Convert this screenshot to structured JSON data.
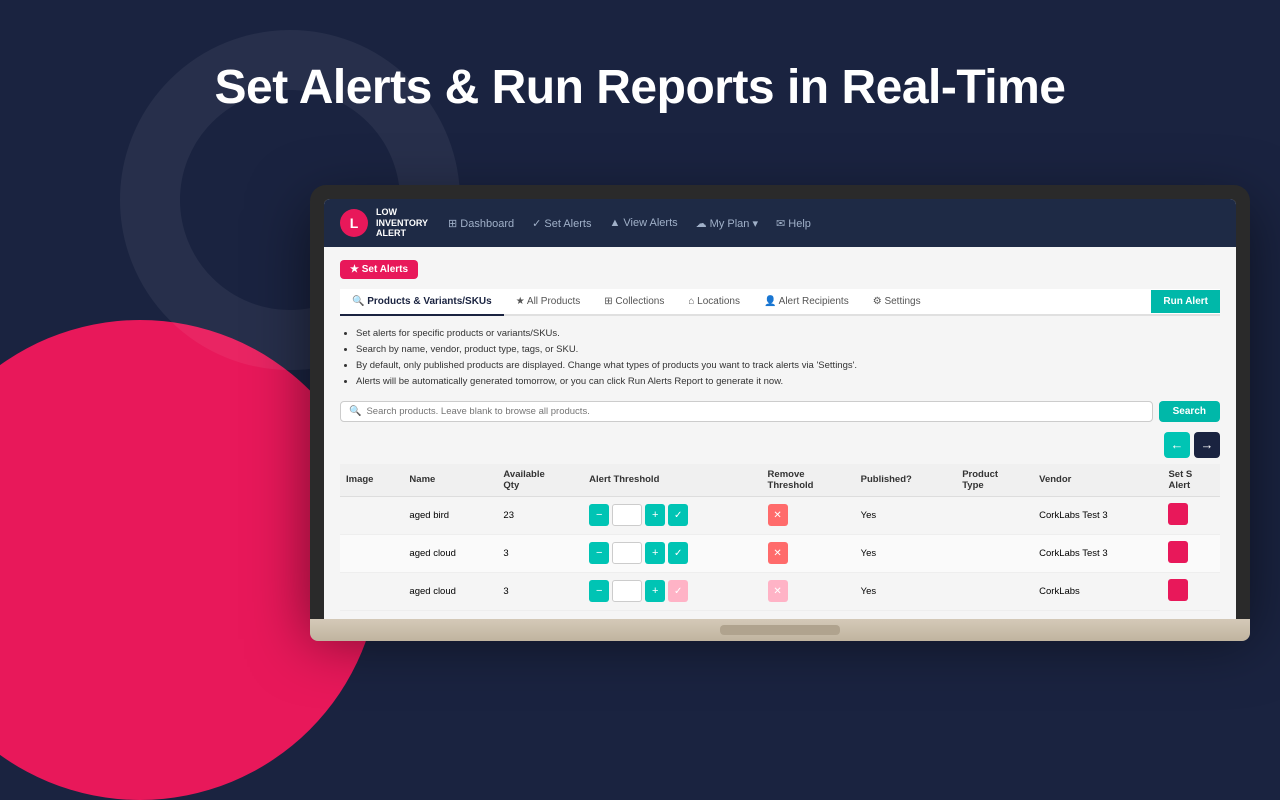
{
  "page": {
    "title": "Set Alerts & Run Reports in Real-Time",
    "background_color": "#1a2340",
    "accent_color": "#e8185a"
  },
  "navbar": {
    "logo_text_line1": "LOW",
    "logo_text_line2": "INVENTORY",
    "logo_text_line3": "ALERT",
    "items": [
      {
        "icon": "⊞",
        "label": "Dashboard"
      },
      {
        "icon": "✓",
        "label": "Set Alerts"
      },
      {
        "icon": "▲",
        "label": "View Alerts"
      },
      {
        "icon": "☁",
        "label": "My Plan",
        "has_dropdown": true
      },
      {
        "icon": "✉",
        "label": "Help"
      }
    ]
  },
  "set_alerts_badge": "★ Set Alerts",
  "tabs": [
    {
      "label": "Products & Variants/SKUs",
      "icon": "🔍",
      "active": true
    },
    {
      "label": "All Products",
      "icon": "★"
    },
    {
      "label": "Collections",
      "icon": "⊞"
    },
    {
      "label": "Locations",
      "icon": "⌂"
    },
    {
      "label": "Alert Recipients",
      "icon": "👤"
    },
    {
      "label": "Settings",
      "icon": "⚙"
    },
    {
      "label": "Run Alert",
      "is_button": true
    }
  ],
  "info_bullets": [
    "Set alerts for specific products or variants/SKUs.",
    "Search by name, vendor, product type, tags, or SKU.",
    "By default, only published products are displayed. Change what types of products you want to track alerts via 'Settings'.",
    "Alerts will be automatically generated tomorrow, or you can click Run Alerts Report to generate it now."
  ],
  "search": {
    "placeholder": "Search products. Leave blank to browse all products.",
    "button_label": "Search"
  },
  "table": {
    "columns": [
      "Image",
      "Name",
      "Available Qty",
      "Alert Threshold",
      "Remove Threshold",
      "Published?",
      "Product Type",
      "Vendor",
      "Set Alert"
    ],
    "rows": [
      {
        "name": "aged bird",
        "available_qty": "23",
        "alert_threshold": "",
        "published": "Yes",
        "product_type": "",
        "vendor": "CorkLabs Test 3"
      },
      {
        "name": "aged cloud",
        "available_qty": "3",
        "alert_threshold": "",
        "published": "Yes",
        "product_type": "",
        "vendor": "CorkLabs Test 3"
      },
      {
        "name": "aged cloud",
        "available_qty": "3",
        "alert_threshold": "",
        "published": "Yes",
        "product_type": "",
        "vendor": "CorkLabs"
      }
    ]
  }
}
